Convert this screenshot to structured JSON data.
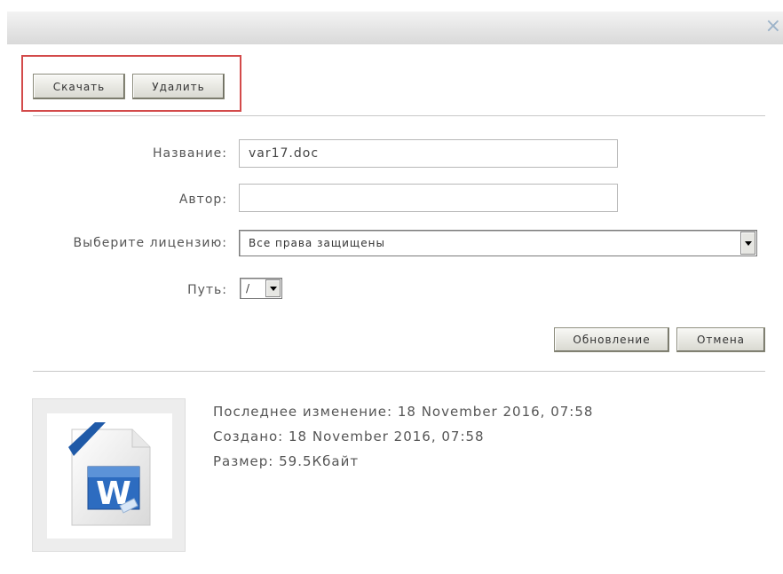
{
  "dialog": {
    "close_symbol": "×",
    "icons": {
      "close": "close-icon",
      "file": "word-document-icon"
    }
  },
  "actions": {
    "download_label": "Скачать",
    "delete_label": "Удалить"
  },
  "form": {
    "name_label": "Название:",
    "name_value": "var17.doc",
    "author_label": "Автор:",
    "author_value": "",
    "license_label": "Выберите лицензию:",
    "license_value": "Все права защищены",
    "path_label": "Путь:",
    "path_value": "/",
    "update_label": "Обновление",
    "cancel_label": "Отмена"
  },
  "file_info": {
    "modified": "Последнее изменение: 18 November 2016, 07:58",
    "created": "Создано: 18 November 2016, 07:58",
    "size": "Размер: 59.5Кбайт"
  },
  "colors": {
    "highlight_border": "#d34a4a",
    "word_blue": "#1f5aa8"
  }
}
